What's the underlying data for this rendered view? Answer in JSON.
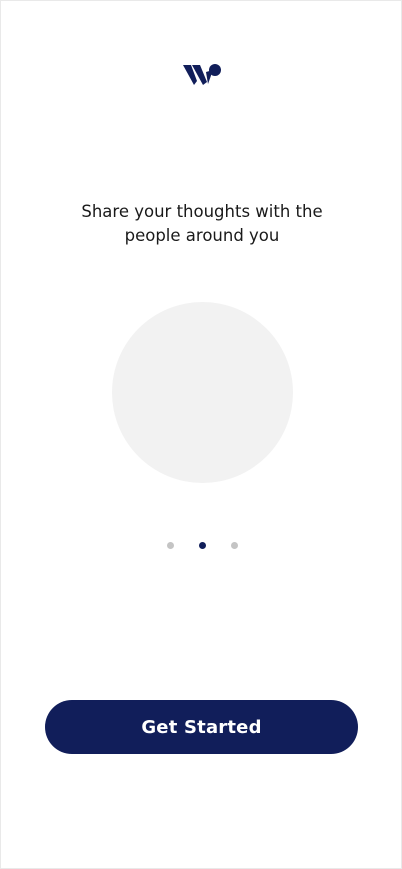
{
  "logo": {
    "icon": "w-logo-icon"
  },
  "onboarding": {
    "message": "Share your thoughts with the people around you",
    "illustration": "placeholder-circle",
    "page_indicator": {
      "total": 3,
      "active": 2
    }
  },
  "actions": {
    "get_started_label": "Get Started"
  },
  "colors": {
    "brand": "#111e5a",
    "dot_inactive": "#c4c4c4",
    "illustration_bg": "#f2f2f2"
  }
}
